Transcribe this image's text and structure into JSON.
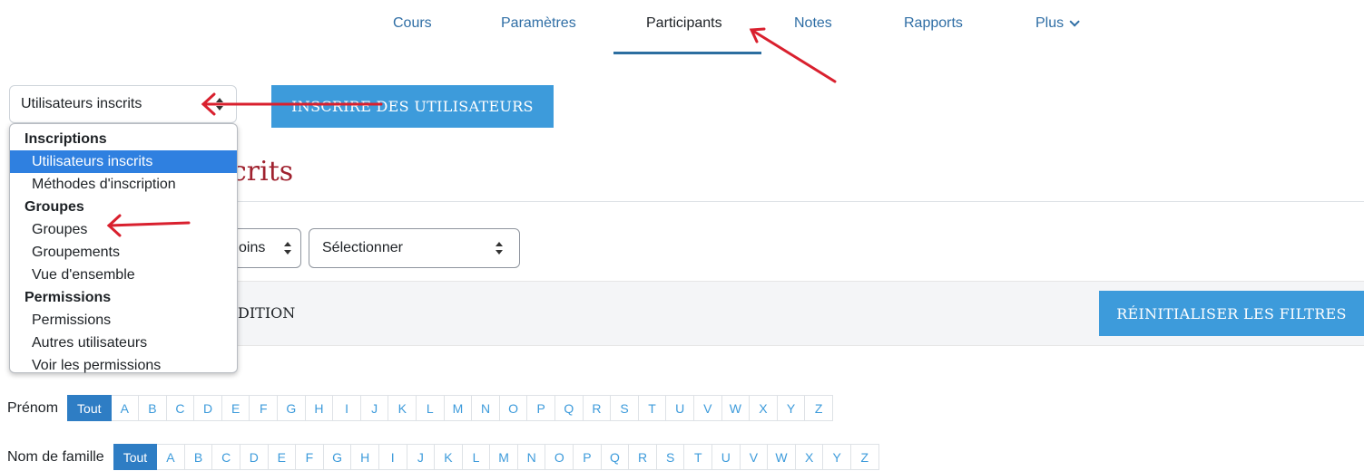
{
  "nav": {
    "items": [
      "Cours",
      "Paramètres",
      "Participants",
      "Notes",
      "Rapports",
      "Plus"
    ],
    "active": "Participants"
  },
  "select_main": {
    "value": "Utilisateurs inscrits"
  },
  "enrol_button": "INSCRIRE DES UTILISATEURS",
  "page_title_visible": "crits",
  "filters": {
    "select_partial": "oins",
    "select2": "Sélectionner",
    "condition_partial": "DITION",
    "reset_button": "RÉINITIALISER LES FILTRES"
  },
  "firstname_filter": {
    "label": "Prénom",
    "all": "Tout"
  },
  "lastname_filter": {
    "label": "Nom de famille",
    "all": "Tout"
  },
  "letters": [
    "A",
    "B",
    "C",
    "D",
    "E",
    "F",
    "G",
    "H",
    "I",
    "J",
    "K",
    "L",
    "M",
    "N",
    "O",
    "P",
    "Q",
    "R",
    "S",
    "T",
    "U",
    "V",
    "W",
    "X",
    "Y",
    "Z"
  ],
  "dropdown": {
    "groups": [
      {
        "label": "Inscriptions",
        "options": [
          "Utilisateurs inscrits",
          "Méthodes d'inscription"
        ]
      },
      {
        "label": "Groupes",
        "options": [
          "Groupes",
          "Groupements",
          "Vue d'ensemble"
        ]
      },
      {
        "label": "Permissions",
        "options": [
          "Permissions",
          "Autres utilisateurs",
          "Voir les permissions"
        ]
      }
    ],
    "selected": "Utilisateurs inscrits"
  },
  "colors": {
    "accent": "#3d9bdb",
    "title": "#a0222f",
    "annotation_arrow": "#d9202e",
    "selected_option": "#2f80e0"
  }
}
